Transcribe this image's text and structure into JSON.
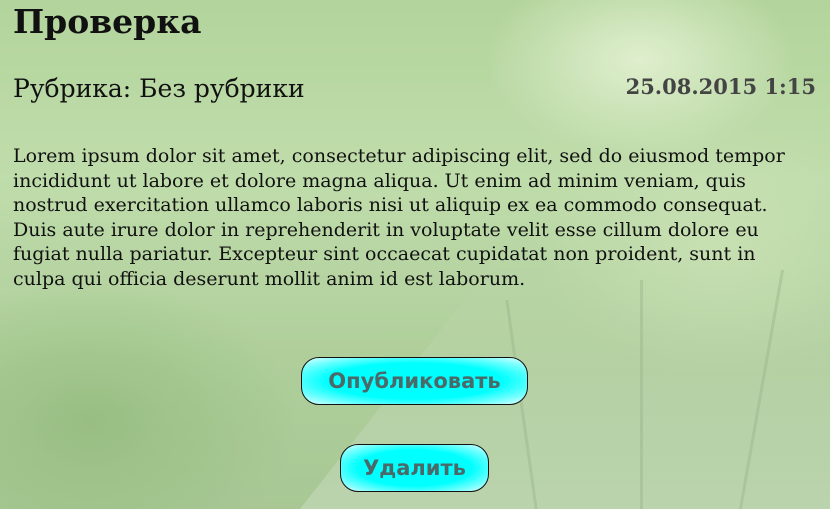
{
  "post": {
    "title": "Проверка",
    "rubric": "Рубрика: Без рубрики",
    "date": "25.08.2015 1:15",
    "body": "Lorem ipsum dolor sit amet, consectetur adipiscing elit, sed do eiusmod tempor incididunt ut labore et dolore magna aliqua. Ut enim ad minim veniam, quis nostrud exercitation ullamco laboris nisi ut aliquip ex ea commodo consequat. Duis aute irure dolor in reprehenderit in voluptate velit esse cillum dolore eu fugiat nulla pariatur. Excepteur sint occaecat cupidatat non proident, sunt in culpa qui officia deserunt mollit anim id est laborum."
  },
  "actions": {
    "publish_label": "Опубликовать",
    "delete_label": "Удалить"
  },
  "colors": {
    "button_fill": "#00ffff",
    "button_text": "#4a6a6a",
    "date_text": "#444444"
  }
}
